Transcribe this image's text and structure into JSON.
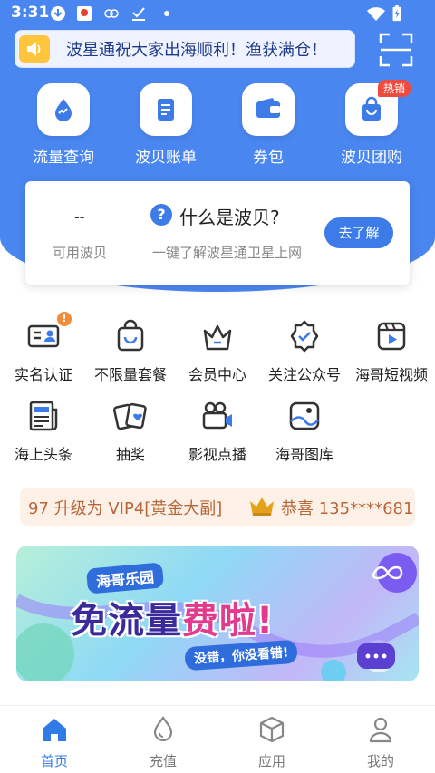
{
  "status_bar": {
    "time": "3:31"
  },
  "notice": {
    "text": "波星通祝大家出海顺利！渔获满仓！"
  },
  "quick_actions": [
    {
      "label": "流量查询",
      "icon": "water-drop-icon"
    },
    {
      "label": "波贝账单",
      "icon": "bill-icon"
    },
    {
      "label": "券包",
      "icon": "wallet-icon"
    },
    {
      "label": "波贝团购",
      "icon": "shopping-bag-icon",
      "badge": "热销"
    }
  ],
  "info_card": {
    "value": "--",
    "value_label": "可用波贝",
    "question": "什么是波贝?",
    "question_sub": "一键了解波星通卫星上网",
    "button": "去了解"
  },
  "services": [
    {
      "label": "实名认证",
      "icon": "id-card-icon",
      "badge": "!"
    },
    {
      "label": "不限量套餐",
      "icon": "package-bag-icon"
    },
    {
      "label": "会员中心",
      "icon": "crown-icon"
    },
    {
      "label": "关注公众号",
      "icon": "verified-badge-icon"
    },
    {
      "label": "海哥短视频",
      "icon": "video-play-icon"
    },
    {
      "label": "海上头条",
      "icon": "newspaper-icon"
    },
    {
      "label": "抽奖",
      "icon": "lottery-cards-icon"
    },
    {
      "label": "影视点播",
      "icon": "movie-camera-icon"
    },
    {
      "label": "海哥图库",
      "icon": "gallery-icon"
    }
  ],
  "ticker": {
    "left_text": "97 升级为 VIP4[黄金大副]",
    "right_text": "恭喜 135****681"
  },
  "banner": {
    "tag": "海哥乐园",
    "headline_a": "免流量",
    "headline_b": "费啦!",
    "sub": "没错，你没看错!"
  },
  "tabs": [
    {
      "label": "首页",
      "active": true
    },
    {
      "label": "充值",
      "active": false
    },
    {
      "label": "应用",
      "active": false
    },
    {
      "label": "我的",
      "active": false
    }
  ],
  "colors": {
    "primary": "#4a86f0",
    "accent": "#3d7be8",
    "ticker_bg": "#fdf1e7",
    "hot_badge": "#ef4b3f"
  }
}
